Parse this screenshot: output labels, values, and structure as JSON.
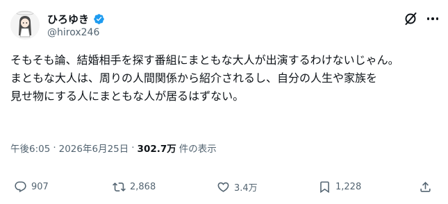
{
  "author": {
    "display_name": "ひろゆき",
    "handle": "@hirox246",
    "verified": true,
    "badge_color": "#1d9bf0"
  },
  "header_icons": [
    "grok-icon",
    "more-options-icon"
  ],
  "post": {
    "lines": [
      "そもそも論、結婚相手を探す番組にまともな大人が出演するわけないじゃん。",
      "まともな大人は、周りの人間関係から紹介されるし、自分の人生や家族を",
      "見せ物にする人にまともな人が居るはずない。"
    ]
  },
  "meta": {
    "time": "午後6:05",
    "separator": "·",
    "date": "2026年6月25日",
    "views_count": "302.7万",
    "views_label": "件の表示"
  },
  "actions": {
    "replies": "907",
    "reposts": "2,868",
    "likes": "3.4万",
    "bookmarks": "1,228"
  },
  "colors": {
    "text_primary": "#0f1419",
    "text_secondary": "#536471",
    "accent": "#1d9bf0"
  }
}
